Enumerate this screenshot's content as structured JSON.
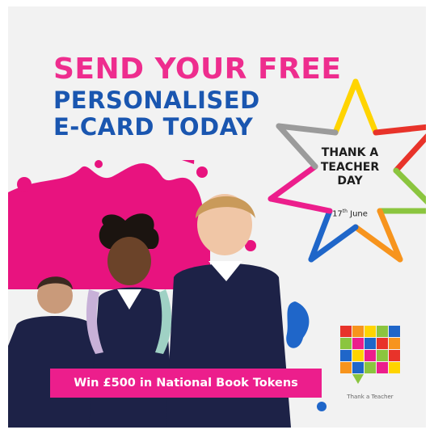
{
  "headline": {
    "line1": "SEND YOUR FREE",
    "line2": "PERSONALISED",
    "line3": "E-CARD TODAY"
  },
  "star": {
    "line1": "THANK A",
    "line2": "TEACHER",
    "line3": "DAY",
    "date_day": "17",
    "date_suffix": "th",
    "date_month": "June"
  },
  "banner": {
    "text": "Win £500 in National Book Tokens"
  },
  "logo": {
    "text": "Thank a Teacher"
  },
  "colors": {
    "pink": "#ee2d8e",
    "blue": "#1a56b0",
    "banner": "#ec1e8c",
    "background": "#f2f2f2"
  },
  "icons": [
    "star-outline-icon",
    "paint-splash",
    "thank-a-teacher-logo"
  ]
}
